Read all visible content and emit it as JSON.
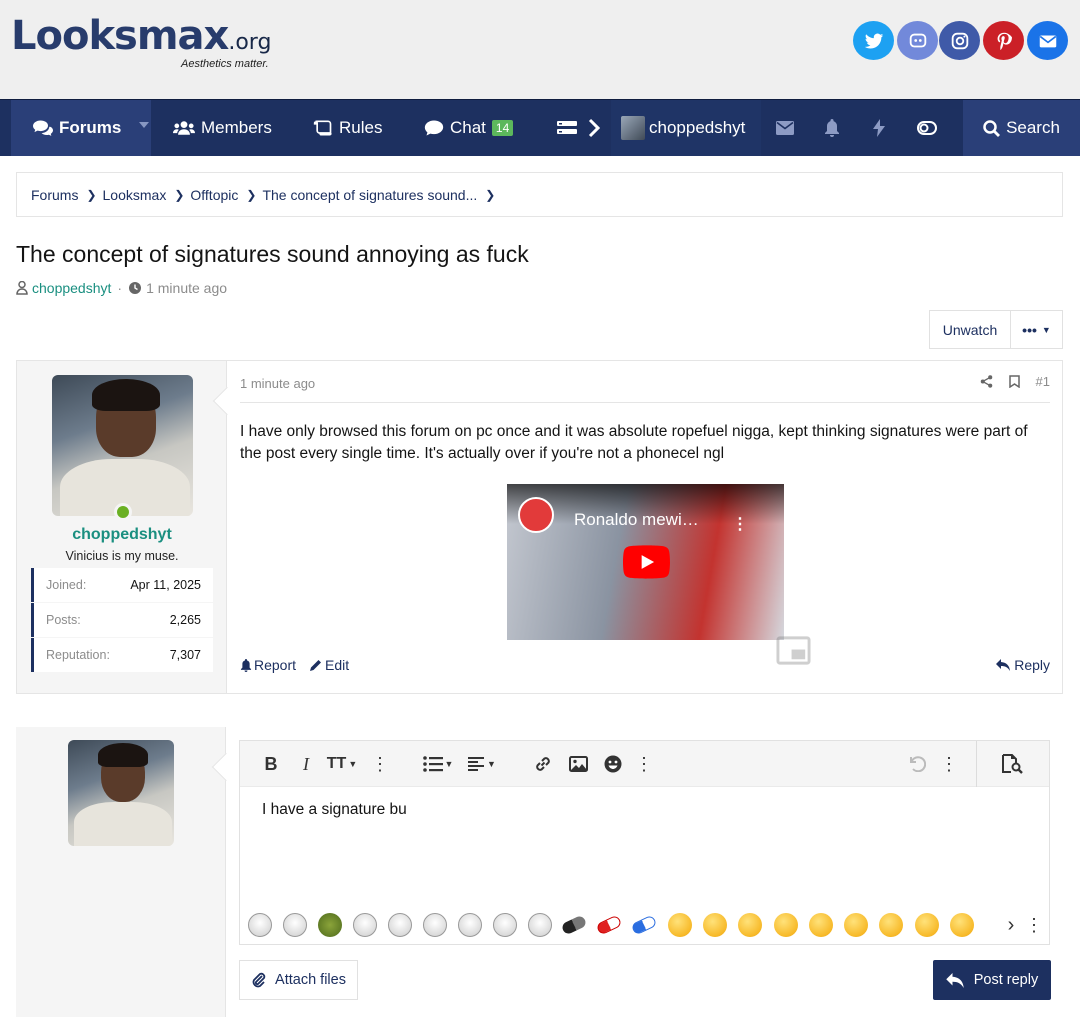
{
  "site": {
    "logo_main": "Looksmax",
    "logo_tld": ".org",
    "tagline": "Aesthetics matter."
  },
  "social": [
    "twitter-icon",
    "discord-icon",
    "instagram-icon",
    "pinterest-icon",
    "envelope-icon"
  ],
  "colors": {
    "nav_bg": "#1d3060",
    "accent_teal": "#1a8f80",
    "online": "#6ab023",
    "twitter": "#1da1f2",
    "discord": "#7289da",
    "instagram": "#3f5aa8",
    "pinterest": "#cb2027",
    "mail": "#1a73e8"
  },
  "nav": {
    "forums": "Forums",
    "members": "Members",
    "rules": "Rules",
    "chat": "Chat",
    "chat_count": "14",
    "username": "choppedshyt",
    "search": "Search"
  },
  "breadcrumb": [
    "Forums",
    "Looksmax",
    "Offtopic",
    "The concept of signatures sound..."
  ],
  "thread": {
    "title": "The concept of signatures sound annoying as fuck",
    "author": "choppedshyt",
    "time": "1 minute ago",
    "unwatch": "Unwatch",
    "more": "•••"
  },
  "post": {
    "username": "choppedshyt",
    "user_title": "Vinicius is my muse.",
    "stats": [
      {
        "k": "Joined:",
        "v": "Apr 11, 2025"
      },
      {
        "k": "Posts:",
        "v": "2,265"
      },
      {
        "k": "Reputation:",
        "v": "7,307"
      }
    ],
    "time": "1 minute ago",
    "number": "#1",
    "text": "I have only browsed this forum on pc once and it was absolute ropefuel nigga, kept thinking signatures were part of the post every single time. It's actually over if you're not a phonecel ngl",
    "video_title": "Ronaldo mewi…",
    "report": "Report",
    "edit": "Edit",
    "reply": "Reply"
  },
  "reply_box": {
    "text": "I have a signature bu",
    "attach": "Attach files",
    "submit": "Post reply"
  }
}
